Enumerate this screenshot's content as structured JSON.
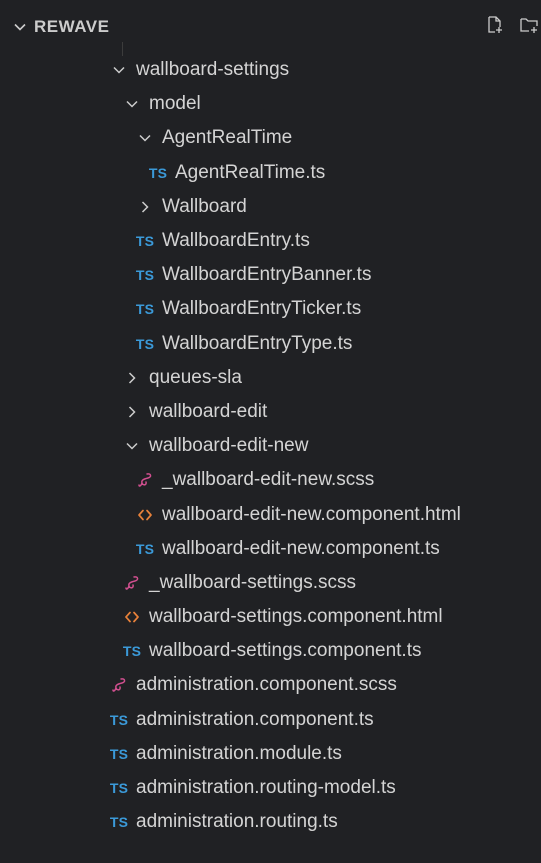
{
  "header": {
    "title": "REWAVE",
    "icons": {
      "collapse": "chevron-down-icon",
      "new_file": "new-file-icon",
      "new_folder": "new-folder-icon"
    }
  },
  "colors": {
    "background": "#202124",
    "text": "#d4d4d4",
    "ts_badge": "#3b9ad9",
    "scss_icon": "#d14f8f",
    "html_icon": "#e8813a"
  },
  "tree": [
    {
      "label": "wallboard-settings",
      "icon": "chevron-down",
      "depth": 1
    },
    {
      "label": "model",
      "icon": "chevron-down",
      "depth": 2
    },
    {
      "label": "AgentRealTime",
      "icon": "chevron-down",
      "depth": 3
    },
    {
      "label": "AgentRealTime.ts",
      "icon": "ts",
      "depth": 4
    },
    {
      "label": "Wallboard",
      "icon": "chevron-right",
      "depth": 3
    },
    {
      "label": "WallboardEntry.ts",
      "icon": "ts",
      "depth": 3
    },
    {
      "label": "WallboardEntryBanner.ts",
      "icon": "ts",
      "depth": 3
    },
    {
      "label": "WallboardEntryTicker.ts",
      "icon": "ts",
      "depth": 3
    },
    {
      "label": "WallboardEntryType.ts",
      "icon": "ts",
      "depth": 3
    },
    {
      "label": "queues-sla",
      "icon": "chevron-right",
      "depth": 2
    },
    {
      "label": "wallboard-edit",
      "icon": "chevron-right",
      "depth": 2
    },
    {
      "label": "wallboard-edit-new",
      "icon": "chevron-down",
      "depth": 2
    },
    {
      "label": "_wallboard-edit-new.scss",
      "icon": "scss",
      "depth": 3
    },
    {
      "label": "wallboard-edit-new.component.html",
      "icon": "html",
      "depth": 3
    },
    {
      "label": "wallboard-edit-new.component.ts",
      "icon": "ts",
      "depth": 3
    },
    {
      "label": "_wallboard-settings.scss",
      "icon": "scss",
      "depth": 2
    },
    {
      "label": "wallboard-settings.component.html",
      "icon": "html",
      "depth": 2
    },
    {
      "label": "wallboard-settings.component.ts",
      "icon": "ts",
      "depth": 2
    },
    {
      "label": "administration.component.scss",
      "icon": "scss",
      "depth": 1
    },
    {
      "label": "administration.component.ts",
      "icon": "ts",
      "depth": 1
    },
    {
      "label": "administration.module.ts",
      "icon": "ts",
      "depth": 1
    },
    {
      "label": "administration.routing-model.ts",
      "icon": "ts",
      "depth": 1
    },
    {
      "label": "administration.routing.ts",
      "icon": "ts",
      "depth": 1
    }
  ],
  "ts_badge_text": "TS"
}
